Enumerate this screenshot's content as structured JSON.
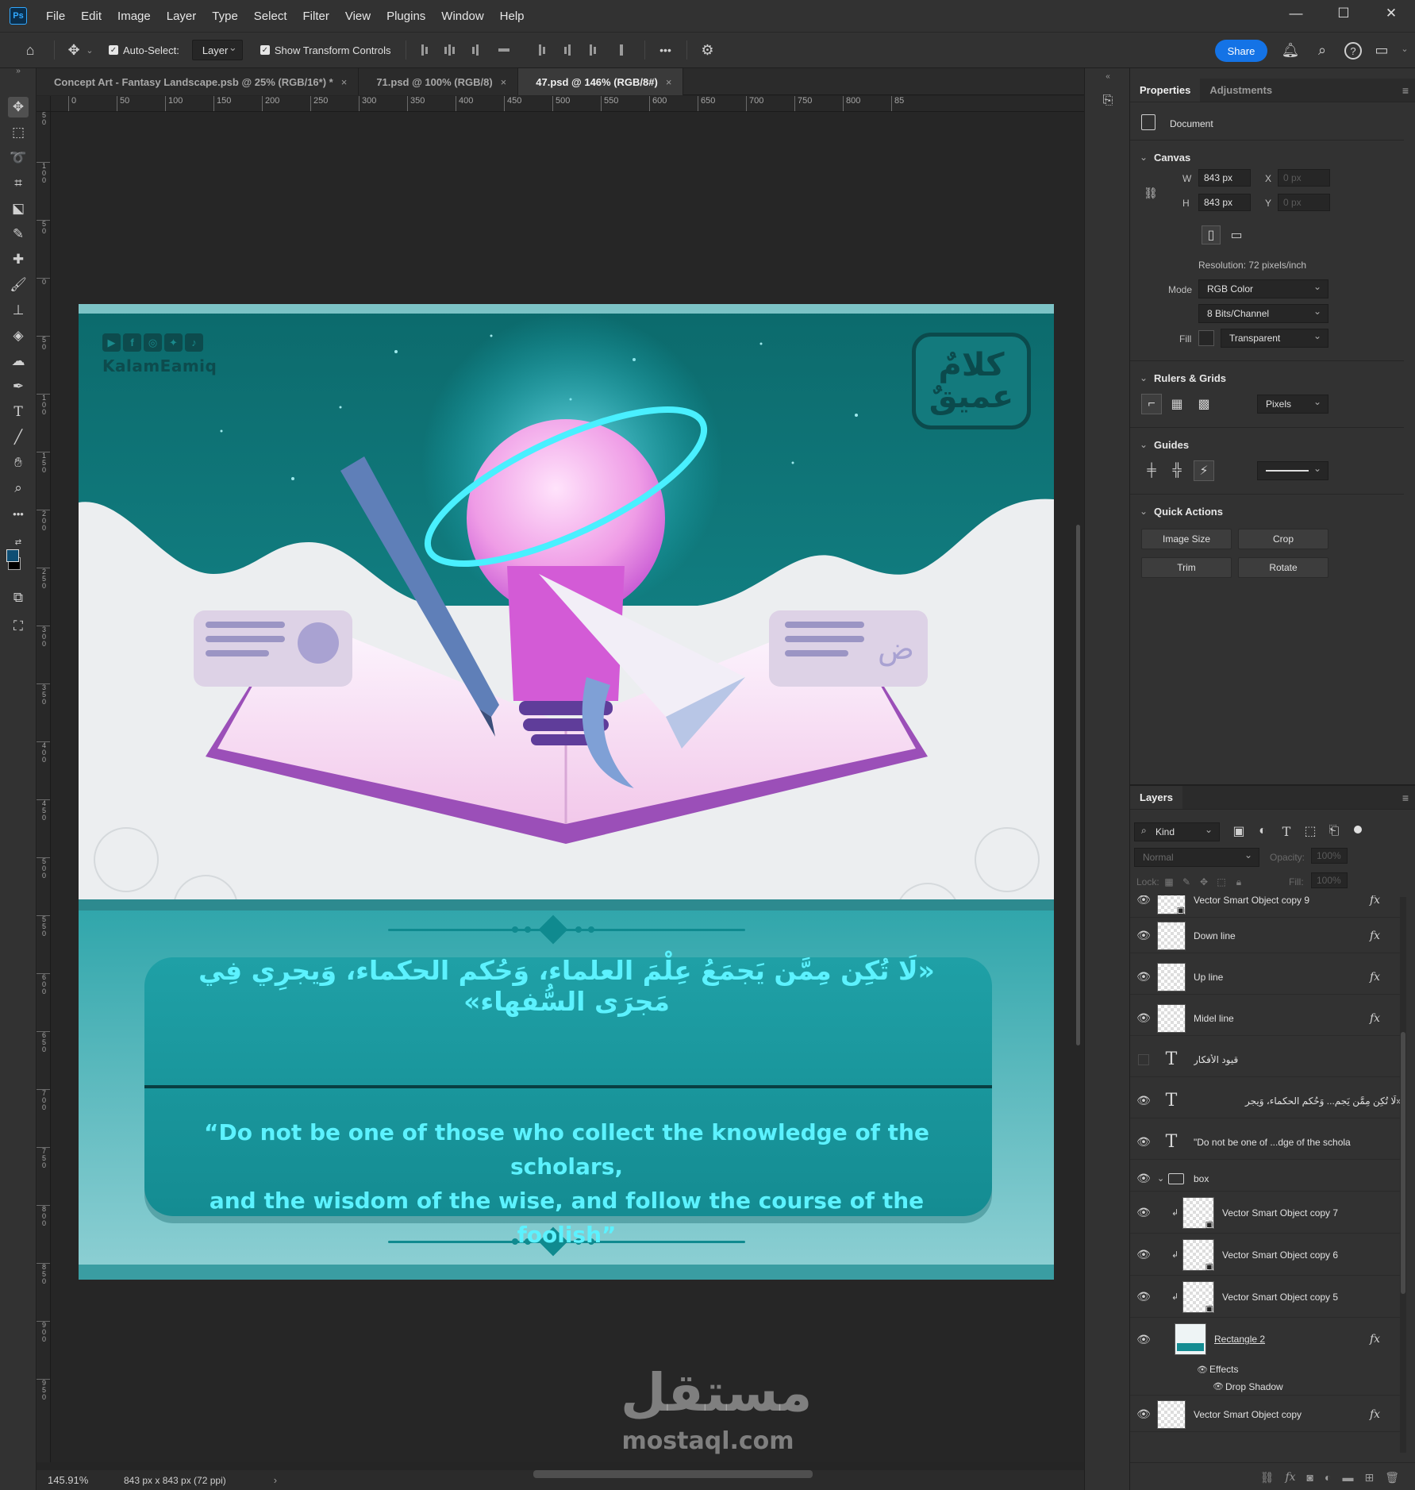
{
  "app": {
    "logo": "Ps"
  },
  "menu": [
    "File",
    "Edit",
    "Image",
    "Layer",
    "Type",
    "Select",
    "Filter",
    "View",
    "Plugins",
    "Window",
    "Help"
  ],
  "window_controls": {
    "minimize": "—",
    "maximize": "☐",
    "close": "✕"
  },
  "options_bar": {
    "auto_select_label": "Auto-Select:",
    "auto_select_target": "Layer",
    "show_transform_label": "Show Transform Controls",
    "more_label": "•••",
    "share_label": "Share"
  },
  "tabs": [
    {
      "label": "Concept Art - Fantasy Landscape.psb @ 25% (RGB/16*) *",
      "close": "×"
    },
    {
      "label": "71.psd @ 100% (RGB/8)",
      "close": "×"
    },
    {
      "label": "47.psd @ 146% (RGB/8#)",
      "close": "×"
    }
  ],
  "ruler_top": [
    "0",
    "50",
    "100",
    "150",
    "200",
    "250",
    "300",
    "350",
    "400",
    "450",
    "500",
    "550",
    "600",
    "650",
    "700",
    "750",
    "800",
    "85"
  ],
  "ruler_left": [
    "1\n5\n0",
    "1\n0\n0",
    "5\n0",
    "0",
    "5\n0",
    "1\n0\n0",
    "1\n5\n0",
    "2\n0\n0",
    "2\n5\n0",
    "3\n0\n0",
    "3\n5\n0",
    "4\n0\n0",
    "4\n5\n0",
    "5\n0\n0",
    "5\n5\n0",
    "6\n0\n0",
    "6\n5\n0",
    "7\n0\n0",
    "7\n5\n0",
    "8\n0\n0",
    "8\n5\n0",
    "9\n0\n0",
    "9\n5\n0"
  ],
  "artwork": {
    "handle": "KalamEamiq",
    "logo_text": "كلامٌ\nعميقٌ",
    "card_glyph": "ض",
    "quote_arabic": "«لَا تُكِن مِمَّن يَجمَعُ عِلْمَ العلماء، وَحُكم الحكماء، وَيجرِي فِي مَجرَى السُّفهاء»",
    "quote_english_line1": "“Do not be one of those who collect the knowledge of the scholars,",
    "quote_english_line2": "and the wisdom of the wise, and follow the course of the foolish”"
  },
  "watermark": {
    "arabic": "مستقل",
    "url": "mostaql.com"
  },
  "status": {
    "zoom": "145.91%",
    "doc_info": "843 px x 843 px (72 ppi)",
    "chevron": "›"
  },
  "properties": {
    "tabs": [
      "Properties",
      "Adjustments"
    ],
    "doc_label": "Document",
    "canvas_title": "Canvas",
    "w_label": "W",
    "w_value": "843 px",
    "h_label": "H",
    "h_value": "843 px",
    "x_label": "X",
    "x_value": "0 px",
    "y_label": "Y",
    "y_value": "0 px",
    "resolution": "Resolution: 72 pixels/inch",
    "mode_label": "Mode",
    "mode_value": "RGB Color",
    "depth_value": "8 Bits/Channel",
    "fill_label": "Fill",
    "fill_value": "Transparent",
    "rulers_title": "Rulers & Grids",
    "units_value": "Pixels",
    "guides_title": "Guides",
    "quick_title": "Quick Actions",
    "btn_image_size": "Image Size",
    "btn_crop": "Crop",
    "btn_trim": "Trim",
    "btn_rotate": "Rotate"
  },
  "layers": {
    "title": "Layers",
    "kind_label": "Kind",
    "blend_mode": "Normal",
    "opacity_label": "Opacity:",
    "opacity_value": "100%",
    "lock_label": "Lock:",
    "fill_label": "Fill:",
    "fill_value": "100%",
    "effects_label": "Effects",
    "drop_shadow_label": "Drop Shadow",
    "items": [
      {
        "name": "Vector Smart Object copy 9",
        "fx": "fx"
      },
      {
        "name": "Down line",
        "fx": "fx"
      },
      {
        "name": "Up line",
        "fx": "fx"
      },
      {
        "name": "Midel line",
        "fx": "fx"
      },
      {
        "name": "قيود الأفكار",
        "type_icon": "T"
      },
      {
        "name": "«لَا تُكِن مِمَّن يَجم... وَحُكم الحكماء، وَيجرِ",
        "type_icon": "T"
      },
      {
        "name": "\"Do not be one of ...dge of the schola",
        "type_icon": "T"
      },
      {
        "name": "box"
      },
      {
        "name": "Vector Smart Object copy 7"
      },
      {
        "name": "Vector Smart Object copy 6"
      },
      {
        "name": "Vector Smart Object copy 5"
      },
      {
        "name": "Rectangle 2",
        "fx": "fx"
      },
      {
        "name": "Vector Smart Object copy",
        "fx": "fx"
      }
    ]
  },
  "colors": {
    "accent": "#1473e6",
    "teal_dark": "#0f6e71",
    "teal_light": "#1b9aa0",
    "quote_cyan": "#5cf2ff",
    "foreground": "#0e4e74",
    "background": "#000000"
  }
}
